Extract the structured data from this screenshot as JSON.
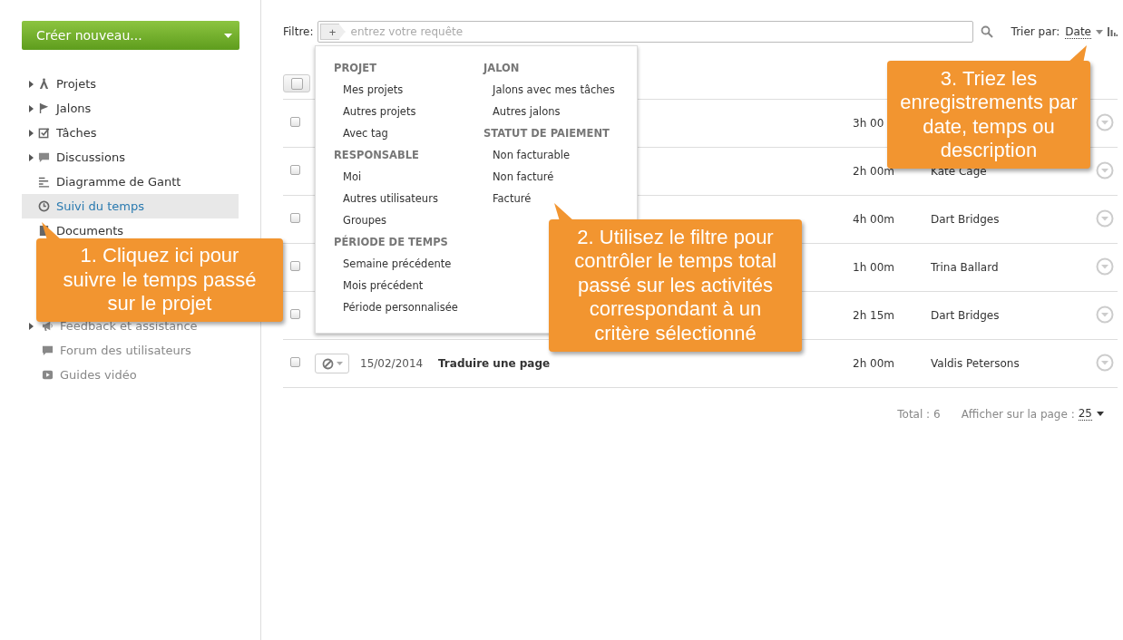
{
  "sidebar": {
    "create_button": "Créer nouveau...",
    "nav_items": [
      {
        "label": "Projets",
        "expandable": true,
        "selected": false
      },
      {
        "label": "Jalons",
        "expandable": true,
        "selected": false
      },
      {
        "label": "Tâches",
        "expandable": true,
        "selected": false
      },
      {
        "label": "Discussions",
        "expandable": true,
        "selected": false
      },
      {
        "label": "Diagramme de Gantt",
        "expandable": false,
        "selected": false
      },
      {
        "label": "Suivi du temps",
        "expandable": false,
        "selected": true
      },
      {
        "label": "Documents",
        "expandable": false,
        "selected": false
      }
    ],
    "help_links": [
      {
        "label": "Feedback et assistance",
        "expandable": true
      },
      {
        "label": "Forum des utilisateurs",
        "expandable": false
      },
      {
        "label": "Guides vidéo",
        "expandable": false
      }
    ]
  },
  "filter": {
    "label": "Filtre:",
    "placeholder": "entrez votre requête",
    "add_button": "+"
  },
  "sort": {
    "label": "Trier par:",
    "value": "Date"
  },
  "filter_menu": {
    "columns": [
      [
        {
          "heading": "PROJET",
          "items": [
            "Mes projets",
            "Autres projets",
            "Avec tag"
          ]
        },
        {
          "heading": "RESPONSABLE",
          "items": [
            "Moi",
            "Autres utilisateurs",
            "Groupes"
          ]
        },
        {
          "heading": "PÉRIODE DE TEMPS",
          "items": [
            "Semaine précédente",
            "Mois précédent",
            "Période personnalisée"
          ]
        }
      ],
      [
        {
          "heading": "JALON",
          "items": [
            "Jalons avec mes tâches",
            "Autres jalons"
          ]
        },
        {
          "heading": "STATUT DE PAIEMENT",
          "items": [
            "Non facturable",
            "Non facturé",
            "Facturé"
          ]
        }
      ]
    ]
  },
  "rows": [
    {
      "checked": false,
      "time": "3h 00"
    },
    {
      "checked": false,
      "time": "2h 00m",
      "user": "Kate Cage"
    },
    {
      "checked": false,
      "time": "4h 00m",
      "user": "Dart Bridges"
    },
    {
      "checked": false,
      "time": "1h 00m",
      "user": "Trina Ballard"
    },
    {
      "checked": false,
      "time": "2h 15m",
      "user": "Dart Bridges"
    },
    {
      "checked": false,
      "date": "15/02/2014",
      "title": "Traduire une page",
      "time": "2h 00m",
      "user": "Valdis Petersons"
    }
  ],
  "footer": {
    "total": "Total : 6",
    "per_page_label": "Afficher sur la page :",
    "per_page": "25"
  },
  "callouts": [
    {
      "text": "1. Cliquez ici pour suivre le temps passé sur le projet"
    },
    {
      "text": "2. Utilisez le filtre pour contrôler le temps total passé sur les activités correspondant à un critère sélectionné"
    },
    {
      "text": "3. Triez les enregistrements par date, temps ou description"
    }
  ]
}
